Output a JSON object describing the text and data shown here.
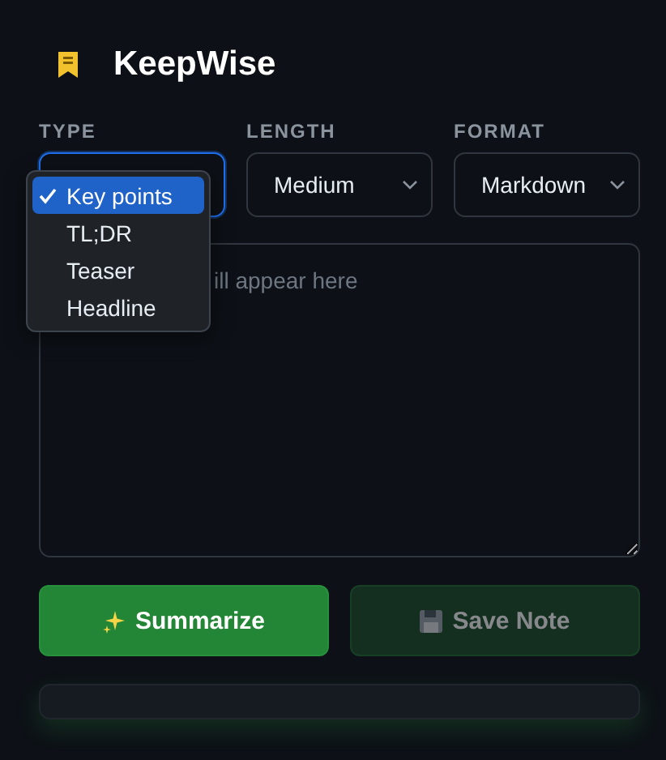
{
  "app": {
    "title": "KeepWise"
  },
  "selects": [
    {
      "label": "TYPE",
      "focused": true
    },
    {
      "label": "LENGTH",
      "value": "Medium",
      "focused": false
    },
    {
      "label": "FORMAT",
      "value": "Markdown",
      "focused": false
    }
  ],
  "type_menu": [
    {
      "label": "Key points",
      "selected": true
    },
    {
      "label": "TL;DR",
      "selected": false
    },
    {
      "label": "Teaser",
      "selected": false
    },
    {
      "label": "Headline",
      "selected": false
    }
  ],
  "output": {
    "placeholder": "ill appear here"
  },
  "buttons": [
    {
      "label": "Summarize",
      "kind": "primary",
      "disabled": false
    },
    {
      "label": "Save Note",
      "kind": "save",
      "disabled": true
    }
  ]
}
